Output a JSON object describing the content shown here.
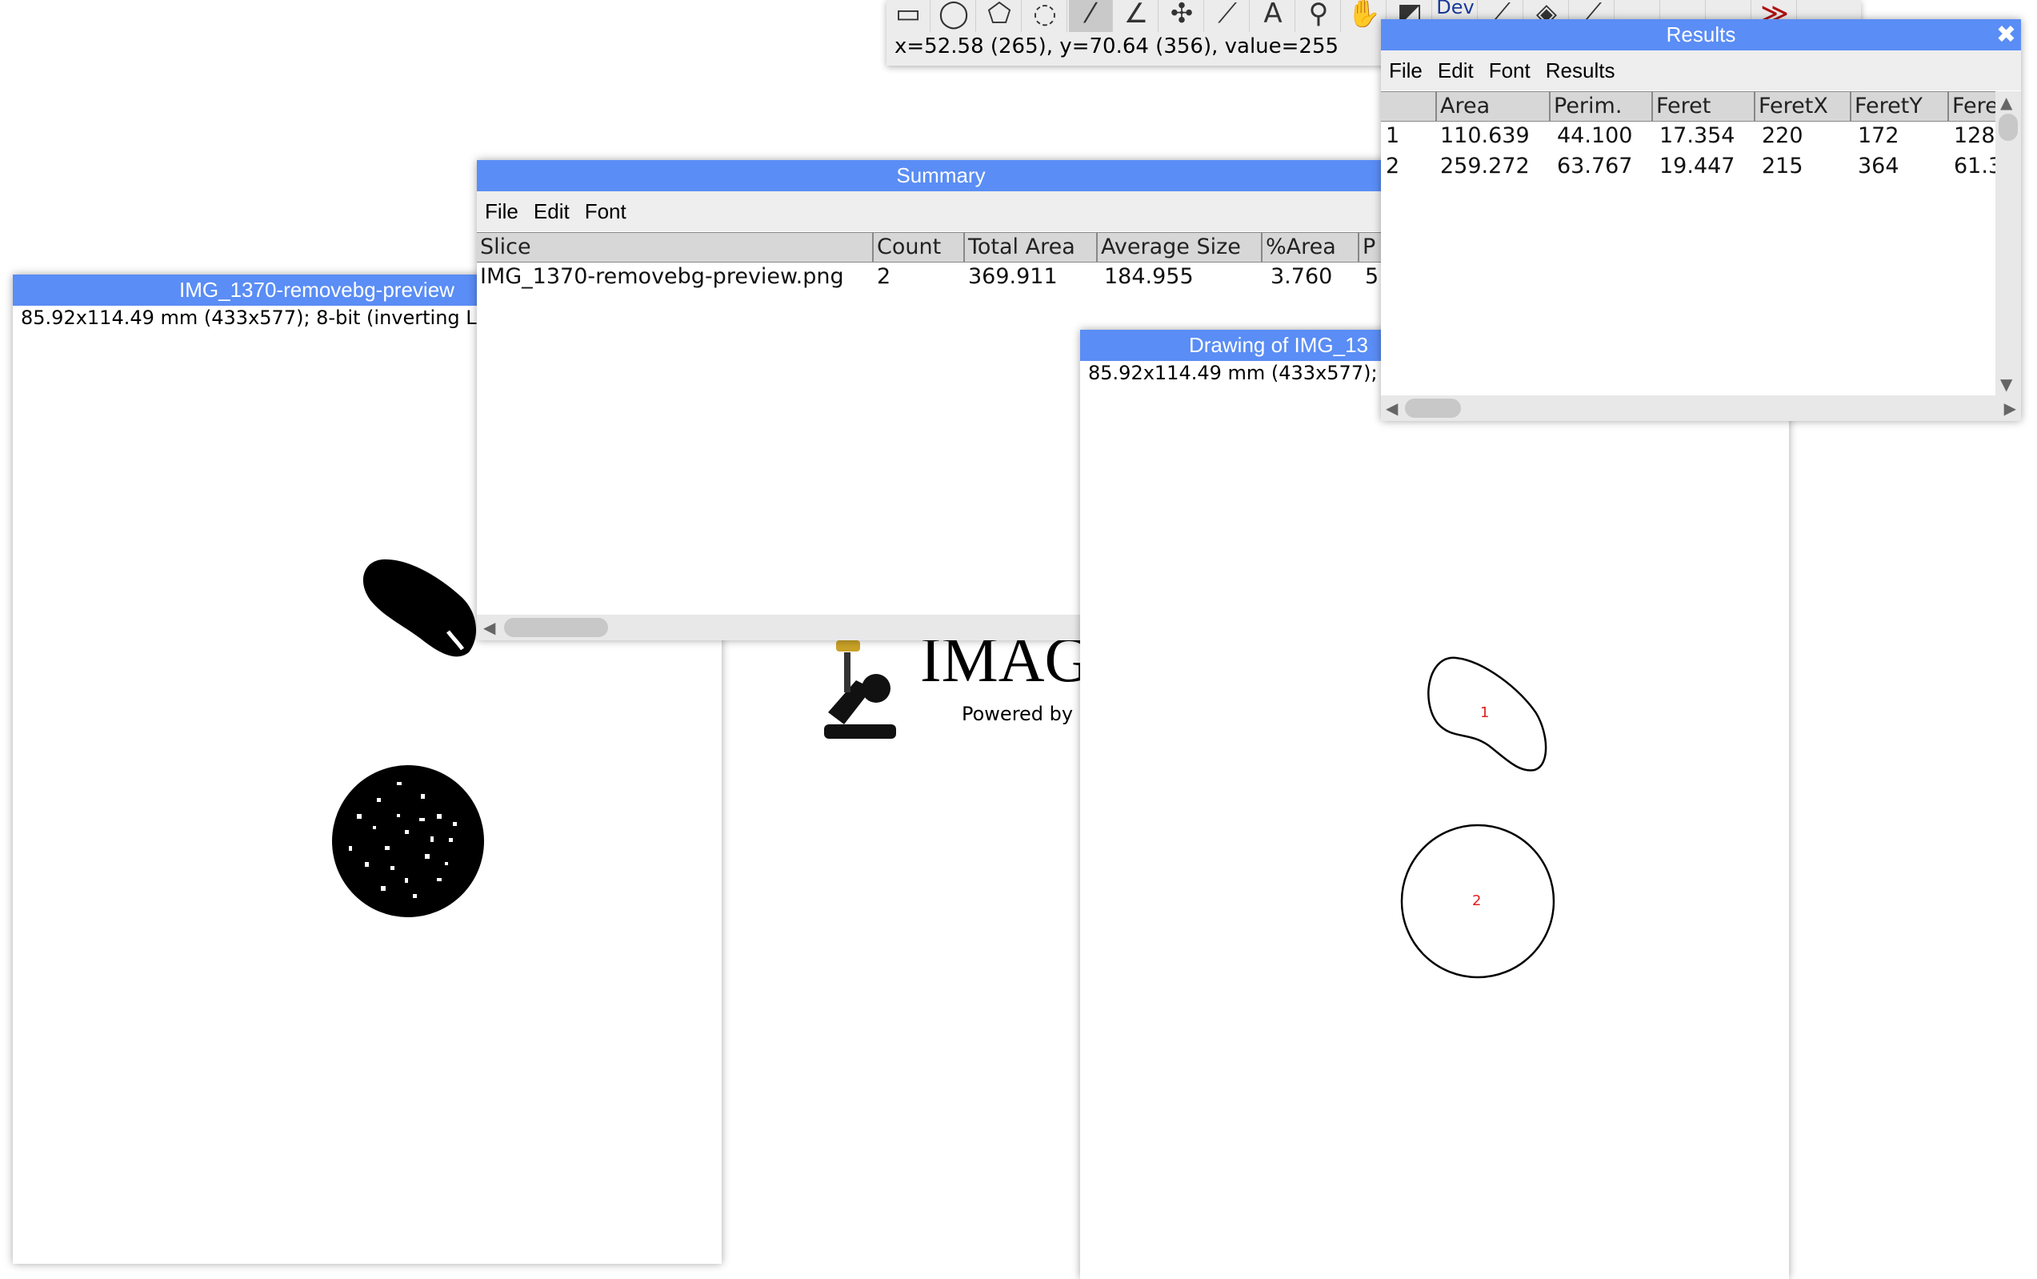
{
  "toolbar": {
    "status": "x=52.58 (265), y=70.64 (356), value=255",
    "tools": [
      "rectangle-icon",
      "oval-icon",
      "polygon-icon",
      "freehand-icon",
      "line-icon",
      "angle-icon",
      "multipoint-icon",
      "wand-icon",
      "text-icon",
      "zoom-icon",
      "hand-icon",
      "dropper-icon",
      "dev-label",
      "brush-icon",
      "flood-icon",
      "pencil-icon",
      "blank-tool",
      "blank-tool",
      "blank-tool",
      "more-tools-icon"
    ],
    "dev_label": "Dev",
    "more_label": "≫"
  },
  "image_window": {
    "title": "IMG_1370-removebg-preview",
    "info": "85.92x114.49 mm (433x577); 8-bit (inverting L"
  },
  "imagej_splash": {
    "logo_text": "IMAG",
    "powered": "Powered by"
  },
  "summary": {
    "title": "Summary",
    "menu": [
      "File",
      "Edit",
      "Font"
    ],
    "columns": [
      "Slice",
      "Count",
      "Total Area",
      "Average Size",
      "%Area",
      "P"
    ],
    "rows": [
      [
        "IMG_1370-removebg-preview.png",
        "2",
        "369.911",
        "184.955",
        "3.760",
        "5"
      ]
    ]
  },
  "drawing_window": {
    "title": "Drawing of IMG_13",
    "info": "85.92x114.49 mm (433x577);",
    "labels": [
      "1",
      "2"
    ]
  },
  "results": {
    "title": "Results",
    "menu": [
      "File",
      "Edit",
      "Font",
      "Results"
    ],
    "columns": [
      "",
      "Area",
      "Perim.",
      "Feret",
      "FeretX",
      "FeretY",
      "Fere"
    ],
    "rows": [
      [
        "1",
        "110.639",
        "44.100",
        "17.354",
        "220",
        "172",
        "128"
      ],
      [
        "2",
        "259.272",
        "63.767",
        "19.447",
        "215",
        "364",
        "61.3"
      ]
    ]
  },
  "colors": {
    "titlebar": "#5a8df5",
    "drawing_label": "#e02020"
  }
}
